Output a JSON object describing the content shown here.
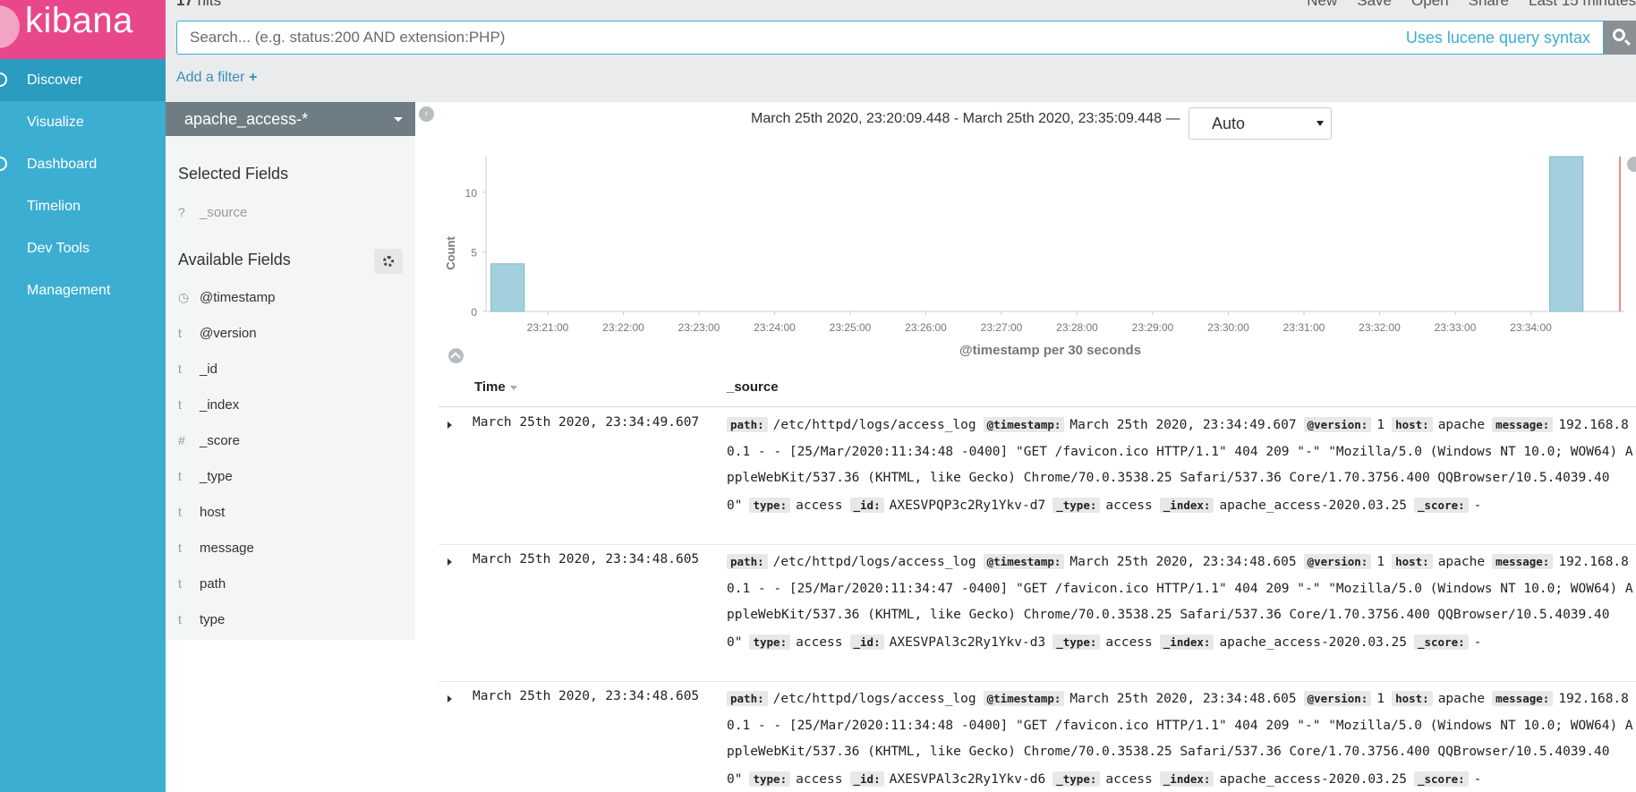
{
  "app": {
    "logo_text": "kibana"
  },
  "sidebar": {
    "items": [
      {
        "label": "Discover",
        "active": true
      },
      {
        "label": "Visualize"
      },
      {
        "label": "Dashboard"
      },
      {
        "label": "Timelion"
      },
      {
        "label": "Dev Tools"
      },
      {
        "label": "Management"
      }
    ]
  },
  "topbar": {
    "hits_count": "17",
    "hits_label": "hits",
    "menu": [
      "New",
      "Save",
      "Open",
      "Share",
      "Last 15 minutes"
    ]
  },
  "search": {
    "placeholder": "Search... (e.g. status:200 AND extension:PHP)",
    "lucene_link": "Uses lucene query syntax"
  },
  "filter": {
    "add_label": "Add a filter",
    "plus": "+"
  },
  "fields": {
    "index_pattern": "apache_access-*",
    "selected_title": "Selected Fields",
    "selected": [
      {
        "type": "?",
        "name": "_source"
      }
    ],
    "available_title": "Available Fields",
    "available": [
      {
        "type": "◷",
        "name": "@timestamp"
      },
      {
        "type": "t",
        "name": "@version"
      },
      {
        "type": "t",
        "name": "_id"
      },
      {
        "type": "t",
        "name": "_index"
      },
      {
        "type": "#",
        "name": "_score"
      },
      {
        "type": "t",
        "name": "_type"
      },
      {
        "type": "t",
        "name": "host"
      },
      {
        "type": "t",
        "name": "message"
      },
      {
        "type": "t",
        "name": "path"
      },
      {
        "type": "t",
        "name": "type"
      }
    ]
  },
  "timerange": {
    "text": "March 25th 2020, 23:20:09.448 - March 25th 2020, 23:35:09.448 —",
    "interval": "Auto"
  },
  "chart_data": {
    "type": "bar",
    "xlabel": "@timestamp per 30 seconds",
    "ylabel": "Count",
    "ylim": [
      0,
      13
    ],
    "y_ticks": [
      0,
      5,
      10
    ],
    "x_ticks": [
      "23:21:00",
      "23:22:00",
      "23:23:00",
      "23:24:00",
      "23:25:00",
      "23:26:00",
      "23:27:00",
      "23:28:00",
      "23:29:00",
      "23:30:00",
      "23:31:00",
      "23:32:00",
      "23:33:00",
      "23:34:00"
    ],
    "bars": [
      {
        "x": "23:20:30",
        "value": 4
      },
      {
        "x": "23:34:30",
        "value": 13
      }
    ],
    "bar_color": "#a4cfdc",
    "now_marker_color": "#e7665a"
  },
  "table": {
    "col_time": "Time",
    "col_source": "_source",
    "rows": [
      {
        "time": "March 25th 2020, 23:34:49.607",
        "fields": [
          {
            "k": "path:",
            "v": "/etc/httpd/logs/access_log"
          },
          {
            "k": "@timestamp:",
            "v": "March 25th 2020, 23:34:49.607"
          },
          {
            "k": "@version:",
            "v": "1"
          },
          {
            "k": "host:",
            "v": "apache"
          },
          {
            "k": "message:",
            "v": "192.168.80.1 - - [25/Mar/2020:11:34:48 -0400] \"GET /favicon.ico HTTP/1.1\" 404 209 \"-\" \"Mozilla/5.0 (Windows NT 10.0; WOW64) AppleWebKit/537.36 (KHTML, like Gecko) Chrome/70.0.3538.25 Safari/537.36 Core/1.70.3756.400 QQBrowser/10.5.4039.400\""
          },
          {
            "k": "type:",
            "v": "access"
          },
          {
            "k": "_id:",
            "v": "AXESVPQP3c2Ry1Ykv-d7"
          },
          {
            "k": "_type:",
            "v": "access"
          },
          {
            "k": "_index:",
            "v": "apache_access-2020.03.25"
          },
          {
            "k": "_score:",
            "v": "-"
          }
        ]
      },
      {
        "time": "March 25th 2020, 23:34:48.605",
        "fields": [
          {
            "k": "path:",
            "v": "/etc/httpd/logs/access_log"
          },
          {
            "k": "@timestamp:",
            "v": "March 25th 2020, 23:34:48.605"
          },
          {
            "k": "@version:",
            "v": "1"
          },
          {
            "k": "host:",
            "v": "apache"
          },
          {
            "k": "message:",
            "v": "192.168.80.1 - - [25/Mar/2020:11:34:47 -0400] \"GET /favicon.ico HTTP/1.1\" 404 209 \"-\" \"Mozilla/5.0 (Windows NT 10.0; WOW64) AppleWebKit/537.36 (KHTML, like Gecko) Chrome/70.0.3538.25 Safari/537.36 Core/1.70.3756.400 QQBrowser/10.5.4039.400\""
          },
          {
            "k": "type:",
            "v": "access"
          },
          {
            "k": "_id:",
            "v": "AXESVPAl3c2Ry1Ykv-d3"
          },
          {
            "k": "_type:",
            "v": "access"
          },
          {
            "k": "_index:",
            "v": "apache_access-2020.03.25"
          },
          {
            "k": "_score:",
            "v": "-"
          }
        ]
      },
      {
        "time": "March 25th 2020, 23:34:48.605",
        "fields": [
          {
            "k": "path:",
            "v": "/etc/httpd/logs/access_log"
          },
          {
            "k": "@timestamp:",
            "v": "March 25th 2020, 23:34:48.605"
          },
          {
            "k": "@version:",
            "v": "1"
          },
          {
            "k": "host:",
            "v": "apache"
          },
          {
            "k": "message:",
            "v": "192.168.80.1 - - [25/Mar/2020:11:34:48 -0400] \"GET /favicon.ico HTTP/1.1\" 404 209 \"-\" \"Mozilla/5.0 (Windows NT 10.0; WOW64) AppleWebKit/537.36 (KHTML, like Gecko) Chrome/70.0.3538.25 Safari/537.36 Core/1.70.3756.400 QQBrowser/10.5.4039.400\""
          },
          {
            "k": "type:",
            "v": "access"
          },
          {
            "k": "_id:",
            "v": "AXESVPAl3c2Ry1Ykv-d6"
          },
          {
            "k": "_type:",
            "v": "access"
          },
          {
            "k": "_index:",
            "v": "apache_access-2020.03.25"
          },
          {
            "k": "_score:",
            "v": "-"
          }
        ]
      }
    ]
  }
}
